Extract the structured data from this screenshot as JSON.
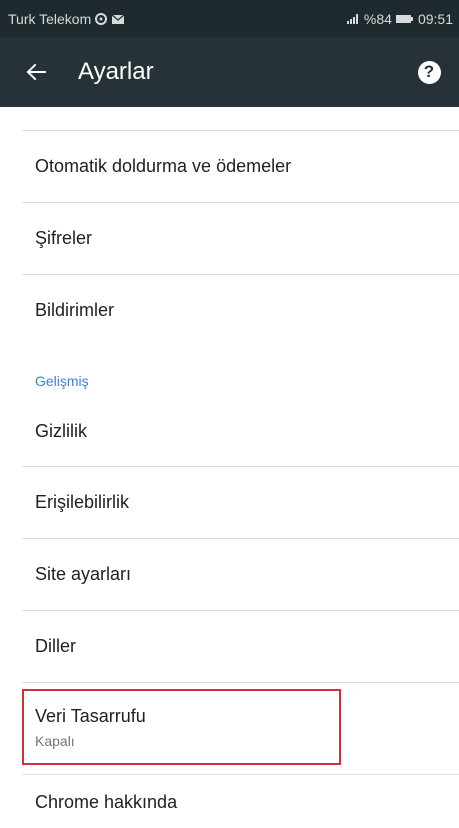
{
  "status_bar": {
    "carrier": "Turk Telekom",
    "battery_percent": "%84",
    "time": "09:51"
  },
  "toolbar": {
    "title": "Ayarlar",
    "back_icon": "arrow-left-icon",
    "help_icon": "help-icon",
    "help_glyph": "?"
  },
  "settings": {
    "items": [
      {
        "label": "Otomatik doldurma ve ödemeler"
      },
      {
        "label": "Şifreler"
      },
      {
        "label": "Bildirimler"
      }
    ],
    "advanced_header": "Gelişmiş",
    "advanced_items": [
      {
        "label": "Gizlilik"
      },
      {
        "label": "Erişilebilirlik"
      },
      {
        "label": "Site ayarları"
      },
      {
        "label": "Diller"
      },
      {
        "label": "Veri Tasarrufu",
        "subtitle": "Kapalı"
      },
      {
        "label": "Chrome hakkında"
      }
    ]
  },
  "colors": {
    "toolbar_bg": "#263238",
    "status_bg": "#1f2a2e",
    "accent": "#3f7fd6",
    "highlight_border": "#d32f3a"
  }
}
